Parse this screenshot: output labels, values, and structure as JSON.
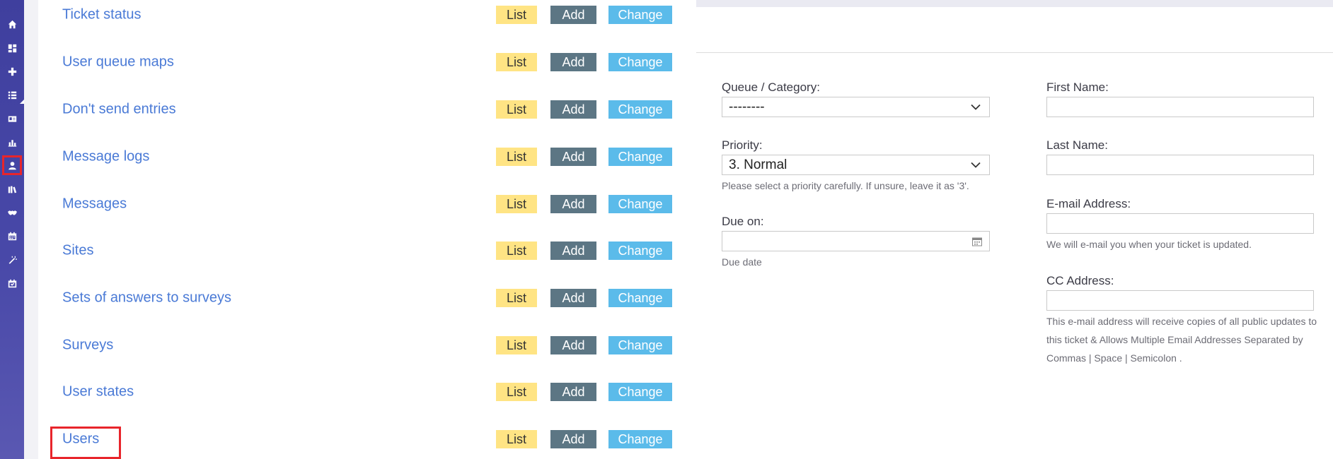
{
  "rail": {
    "items": [
      {
        "icon": "home-icon"
      },
      {
        "icon": "dashboard-icon"
      },
      {
        "icon": "plus-icon"
      },
      {
        "icon": "list-icon"
      },
      {
        "icon": "id-card-icon"
      },
      {
        "icon": "bar-chart-icon"
      },
      {
        "icon": "user-icon",
        "active": true
      },
      {
        "icon": "books-icon"
      },
      {
        "icon": "handshake-icon"
      },
      {
        "icon": "calendar-icon"
      },
      {
        "icon": "magic-wand-icon"
      },
      {
        "icon": "calendar-check-icon"
      }
    ]
  },
  "admin_list": {
    "list_label": "List",
    "add_label": "Add",
    "change_label": "Change",
    "models": [
      "Ticket status",
      "User queue maps",
      "Don't send entries",
      "Message logs",
      "Messages",
      "Sites",
      "Sets of answers to surveys",
      "Surveys",
      "User states",
      "Users"
    ]
  },
  "form": {
    "queue": {
      "label": "Queue / Category:",
      "value": "--------"
    },
    "priority": {
      "label": "Priority:",
      "value": "3. Normal",
      "help": "Please select a priority carefully. If unsure, leave it as '3'."
    },
    "due_on": {
      "label": "Due on:",
      "help": "Due date"
    },
    "first_name": {
      "label": "First Name:"
    },
    "last_name": {
      "label": "Last Name:"
    },
    "email": {
      "label": "E-mail Address:",
      "help": "We will e-mail you when your ticket is updated."
    },
    "cc": {
      "label": "CC Address:",
      "help": "This e-mail address will receive copies of all public updates to this ticket & Allows Multiple Email Addresses Separated by Commas | Space | Semicolon ."
    }
  },
  "colors": {
    "rail": "#4545a5",
    "link": "#4a7ad6",
    "list_btn": "#ffe484",
    "add_btn": "#5c7684",
    "change_btn": "#5bbbea",
    "highlight": "#e8252b"
  }
}
